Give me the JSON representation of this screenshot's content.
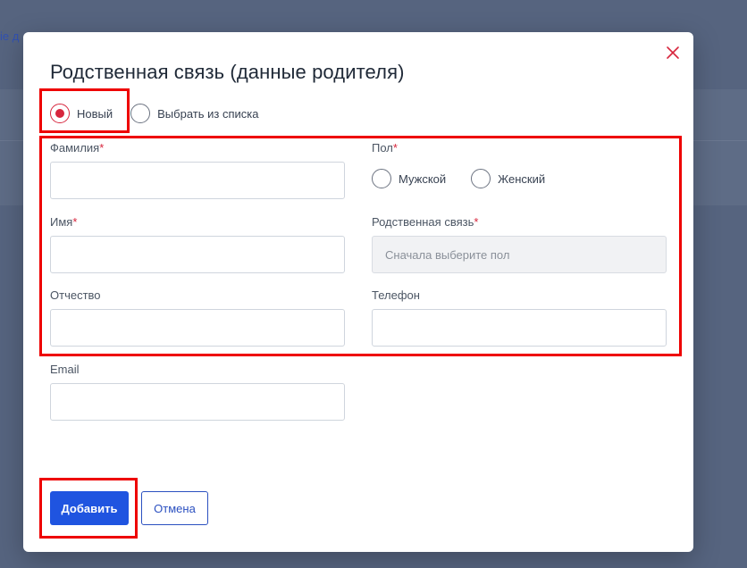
{
  "background": {
    "link_fragment": "ie д"
  },
  "modal": {
    "title": "Родственная связь (данные родителя)",
    "close_icon": "close-x-icon",
    "source_options": [
      {
        "label": "Новый",
        "checked": true
      },
      {
        "label": "Выбрать из списка",
        "checked": false
      }
    ],
    "fields": {
      "last_name": {
        "label": "Фамилия",
        "required": "*",
        "value": ""
      },
      "first_name": {
        "label": "Имя",
        "required": "*",
        "value": ""
      },
      "patronymic": {
        "label": "Отчество",
        "value": ""
      },
      "email": {
        "label": "Email",
        "value": ""
      },
      "gender": {
        "label": "Пол",
        "required": "*",
        "options": [
          {
            "label": "Мужской",
            "checked": false
          },
          {
            "label": "Женский",
            "checked": false
          }
        ]
      },
      "relation": {
        "label": "Родственная связь",
        "required": "*",
        "placeholder": "Сначала выберите пол",
        "value": ""
      },
      "phone": {
        "label": "Телефон",
        "value": ""
      }
    },
    "buttons": {
      "add": "Добавить",
      "cancel": "Отмена"
    }
  },
  "colors": {
    "accent": "#1f54e0",
    "required": "#d7263d",
    "annotation": "#ee0000",
    "overlay": "#56647f"
  }
}
